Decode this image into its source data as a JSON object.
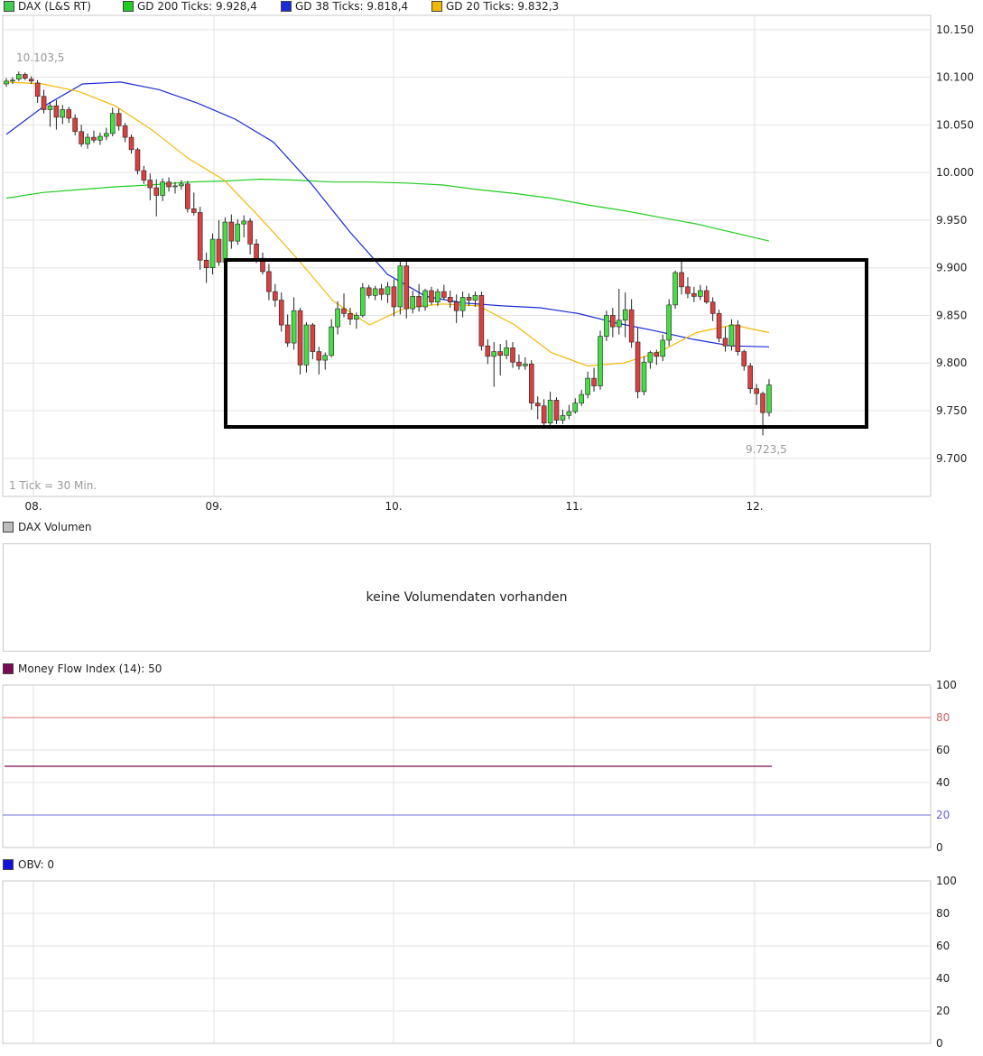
{
  "legend": [
    {
      "label": "DAX (L&S RT)",
      "color": "#3fce4e"
    },
    {
      "label": "GD 200 Ticks: 9.928,4",
      "color": "#22cc22"
    },
    {
      "label": "GD 38 Ticks: 9.818,4",
      "color": "#1a2bd8"
    },
    {
      "label": "GD 20 Ticks: 9.832,3",
      "color": "#f5b800"
    }
  ],
  "tick_note": "1 Tick = 30 Min.",
  "high_label": "10.103,5",
  "low_label": "9.723,5",
  "volume_panel": {
    "label": "DAX Volumen",
    "swatch": "#bdbdbd",
    "message": "keine Volumendaten vorhanden"
  },
  "mfi_panel": {
    "label": "Money Flow Index (14): 50",
    "swatch": "#7a0a55",
    "y_ticks": [
      "100",
      "80",
      "60",
      "40",
      "20",
      "0"
    ]
  },
  "obv_panel": {
    "label": "OBV: 0",
    "swatch": "#1010dd",
    "y_ticks": [
      "100",
      "80",
      "60",
      "40",
      "20",
      "0"
    ]
  },
  "chart_data": [
    {
      "type": "candlestick",
      "x_ticks": [
        "08.",
        "09.",
        "10.",
        "11.",
        "12."
      ],
      "y_ticks": [
        "10.150",
        "10.100",
        "10.050",
        "10.000",
        "9.950",
        "9.900",
        "9.850",
        "9.800",
        "9.750",
        "9.700"
      ],
      "ylim": [
        9660,
        10165
      ],
      "grid": true,
      "up_color": "#44dd44",
      "down_color": "#d94040",
      "candles": [
        [
          10093,
          10099,
          10090,
          10096
        ],
        [
          10096,
          10100,
          10093,
          10097
        ],
        [
          10098,
          10106,
          10096,
          10103
        ],
        [
          10103,
          10105,
          10097,
          10099
        ],
        [
          10098,
          10101,
          10093,
          10096
        ],
        [
          10094,
          10097,
          10073,
          10080
        ],
        [
          10080,
          10087,
          10062,
          10066
        ],
        [
          10066,
          10074,
          10048,
          10070
        ],
        [
          10070,
          10076,
          10045,
          10058
        ],
        [
          10058,
          10071,
          10051,
          10066
        ],
        [
          10066,
          10069,
          10052,
          10057
        ],
        [
          10057,
          10061,
          10039,
          10043
        ],
        [
          10043,
          10050,
          10027,
          10030
        ],
        [
          10030,
          10041,
          10025,
          10037
        ],
        [
          10037,
          10044,
          10031,
          10034
        ],
        [
          10034,
          10042,
          10029,
          10038
        ],
        [
          10038,
          10047,
          10034,
          10041
        ],
        [
          10041,
          10068,
          10038,
          10062
        ],
        [
          10062,
          10067,
          10044,
          10049
        ],
        [
          10049,
          10052,
          10032,
          10037
        ],
        [
          10037,
          10040,
          10020,
          10024
        ],
        [
          10024,
          10026,
          9998,
          10002
        ],
        [
          10002,
          10007,
          9988,
          9992
        ],
        [
          9992,
          9999,
          9971,
          9984
        ],
        [
          9984,
          9993,
          9954,
          9976
        ],
        [
          9976,
          9994,
          9970,
          9990
        ],
        [
          9990,
          9995,
          9980,
          9985
        ],
        [
          9985,
          9990,
          9978,
          9986
        ],
        [
          9986,
          9992,
          9982,
          9988
        ],
        [
          9988,
          9991,
          9958,
          9962
        ],
        [
          9962,
          9979,
          9955,
          9958
        ],
        [
          9958,
          9964,
          9898,
          9908
        ],
        [
          9908,
          9916,
          9884,
          9900
        ],
        [
          9900,
          9936,
          9893,
          9930
        ],
        [
          9930,
          9950,
          9902,
          9906
        ],
        [
          9906,
          9953,
          9900,
          9948
        ],
        [
          9948,
          9956,
          9920,
          9928
        ],
        [
          9928,
          9951,
          9924,
          9946
        ],
        [
          9946,
          9955,
          9932,
          9949
        ],
        [
          9949,
          9952,
          9914,
          9925
        ],
        [
          9925,
          9930,
          9905,
          9910
        ],
        [
          9910,
          9916,
          9893,
          9896
        ],
        [
          9896,
          9904,
          9866,
          9875
        ],
        [
          9875,
          9883,
          9859,
          9866
        ],
        [
          9866,
          9874,
          9833,
          9840
        ],
        [
          9840,
          9851,
          9817,
          9821
        ],
        [
          9821,
          9869,
          9814,
          9855
        ],
        [
          9855,
          9858,
          9788,
          9798
        ],
        [
          9798,
          9843,
          9790,
          9840
        ],
        [
          9840,
          9842,
          9804,
          9812
        ],
        [
          9812,
          9817,
          9788,
          9803
        ],
        [
          9803,
          9811,
          9793,
          9808
        ],
        [
          9808,
          9846,
          9806,
          9838
        ],
        [
          9838,
          9865,
          9830,
          9857
        ],
        [
          9857,
          9873,
          9848,
          9852
        ],
        [
          9852,
          9858,
          9840,
          9846
        ],
        [
          9846,
          9853,
          9836,
          9850
        ],
        [
          9850,
          9884,
          9848,
          9879
        ],
        [
          9879,
          9882,
          9868,
          9871
        ],
        [
          9871,
          9881,
          9866,
          9878
        ],
        [
          9878,
          9883,
          9866,
          9872
        ],
        [
          9872,
          9885,
          9863,
          9880
        ],
        [
          9880,
          9888,
          9849,
          9859
        ],
        [
          9859,
          9908,
          9851,
          9902
        ],
        [
          9902,
          9910,
          9847,
          9857
        ],
        [
          9857,
          9876,
          9852,
          9870
        ],
        [
          9870,
          9883,
          9854,
          9859
        ],
        [
          9859,
          9878,
          9855,
          9876
        ],
        [
          9876,
          9880,
          9861,
          9864
        ],
        [
          9864,
          9878,
          9860,
          9875
        ],
        [
          9875,
          9882,
          9866,
          9869
        ],
        [
          9869,
          9876,
          9858,
          9864
        ],
        [
          9864,
          9872,
          9842,
          9855
        ],
        [
          9855,
          9875,
          9848,
          9869
        ],
        [
          9869,
          9873,
          9860,
          9866
        ],
        [
          9866,
          9875,
          9859,
          9871
        ],
        [
          9871,
          9875,
          9813,
          9818
        ],
        [
          9818,
          9825,
          9799,
          9807
        ],
        [
          9807,
          9822,
          9775,
          9812
        ],
        [
          9812,
          9820,
          9787,
          9808
        ],
        [
          9808,
          9824,
          9804,
          9816
        ],
        [
          9816,
          9822,
          9795,
          9801
        ],
        [
          9801,
          9809,
          9793,
          9797
        ],
        [
          9797,
          9806,
          9793,
          9799
        ],
        [
          9799,
          9803,
          9751,
          9758
        ],
        [
          9758,
          9765,
          9741,
          9755
        ],
        [
          9755,
          9762,
          9733,
          9737
        ],
        [
          9737,
          9770,
          9735,
          9761
        ],
        [
          9761,
          9764,
          9736,
          9740
        ],
        [
          9740,
          9751,
          9736,
          9745
        ],
        [
          9745,
          9756,
          9741,
          9749
        ],
        [
          9749,
          9763,
          9747,
          9758
        ],
        [
          9758,
          9772,
          9755,
          9767
        ],
        [
          9767,
          9791,
          9763,
          9784
        ],
        [
          9784,
          9795,
          9770,
          9776
        ],
        [
          9776,
          9834,
          9772,
          9828
        ],
        [
          9828,
          9855,
          9823,
          9850
        ],
        [
          9850,
          9858,
          9827,
          9838
        ],
        [
          9838,
          9878,
          9830,
          9845
        ],
        [
          9845,
          9874,
          9827,
          9856
        ],
        [
          9856,
          9867,
          9816,
          9822
        ],
        [
          9822,
          9837,
          9763,
          9770
        ],
        [
          9770,
          9807,
          9766,
          9801
        ],
        [
          9801,
          9813,
          9794,
          9811
        ],
        [
          9811,
          9814,
          9798,
          9807
        ],
        [
          9807,
          9830,
          9802,
          9824
        ],
        [
          9824,
          9867,
          9818,
          9861
        ],
        [
          9861,
          9897,
          9857,
          9895
        ],
        [
          9895,
          9907,
          9872,
          9880
        ],
        [
          9880,
          9890,
          9868,
          9873
        ],
        [
          9873,
          9880,
          9864,
          9870
        ],
        [
          9870,
          9882,
          9866,
          9876
        ],
        [
          9876,
          9881,
          9862,
          9864
        ],
        [
          9864,
          9869,
          9844,
          9852
        ],
        [
          9852,
          9856,
          9822,
          9826
        ],
        [
          9826,
          9838,
          9812,
          9818
        ],
        [
          9818,
          9846,
          9813,
          9840
        ],
        [
          9840,
          9845,
          9808,
          9812
        ],
        [
          9812,
          9814,
          9792,
          9797
        ],
        [
          9797,
          9800,
          9768,
          9773
        ],
        [
          9773,
          9778,
          9756,
          9768
        ],
        [
          9768,
          9770,
          9724,
          9748
        ],
        [
          9748,
          9783,
          9744,
          9777
        ]
      ],
      "ma_series": [
        {
          "values": [
            9973,
            9979,
            9982,
            9985,
            9987,
            9990,
            9991,
            9993,
            9992,
            9990,
            9990,
            9989,
            9987,
            9982,
            9978,
            9973,
            9966,
            9960,
            9953,
            9946,
            9937,
            9928
          ],
          "color": "#22cc22"
        },
        {
          "values": [
            10040,
            10070,
            10093,
            10095,
            10087,
            10073,
            10056,
            10032,
            9988,
            9938,
            9893,
            9870,
            9863,
            9860,
            9858,
            9852,
            9842,
            9834,
            9825,
            9818,
            9817
          ],
          "color": "#1a2bd8"
        },
        {
          "values": [
            10095,
            10093,
            10085,
            10070,
            10045,
            10015,
            9992,
            9952,
            9910,
            9865,
            9840,
            9858,
            9862,
            9860,
            9840,
            9811,
            9797,
            9800,
            9812,
            9832,
            9840,
            9832
          ],
          "color": "#f5b800"
        }
      ]
    },
    {
      "type": "line",
      "title": "Money Flow Index (14): 50",
      "ylim": [
        0,
        100
      ],
      "y_ticks": [
        "100",
        "80",
        "60",
        "40",
        "20",
        "0"
      ],
      "reference_lines": [
        80,
        20
      ],
      "values": [
        50
      ]
    },
    {
      "type": "line",
      "title": "OBV: 0",
      "ylim": [
        0,
        100
      ],
      "y_ticks": [
        "100",
        "80",
        "60",
        "40",
        "20",
        "0"
      ],
      "values": []
    }
  ]
}
